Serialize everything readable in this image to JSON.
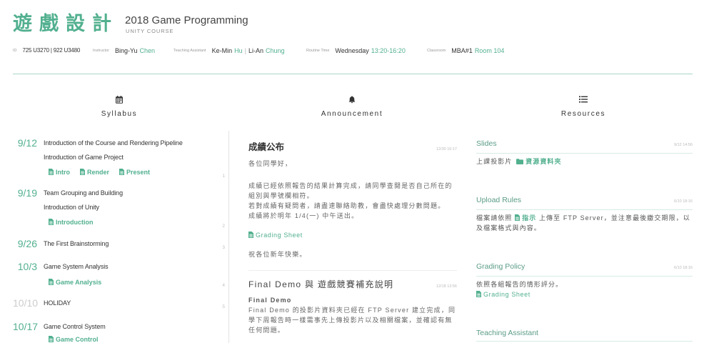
{
  "header": {
    "title": "遊戲設計",
    "course_name": "2018 Game Programming",
    "course_sub": "UNITY COURSE"
  },
  "meta": {
    "id": {
      "label": "ID",
      "value": "725 U3270 | 922 U3480"
    },
    "instructor": {
      "label": "Instructor",
      "first": "Bing-Yu",
      "last": "Chen"
    },
    "ta": {
      "label": "Teaching Assistant",
      "first1": "Ke-Min",
      "last1": "Hu",
      "sep": "|",
      "first2": "Li-An",
      "last2": "Chung"
    },
    "time": {
      "label": "Routine Time",
      "day": "Wednesday",
      "hours": "13:20-16:20"
    },
    "classroom": {
      "label": "Classroom",
      "building": "MBA#1",
      "room": "Room 104"
    }
  },
  "sections": {
    "syllabus": {
      "label": "Syllabus",
      "icon": "calendar-icon"
    },
    "announcement": {
      "label": "Announcement",
      "icon": "bell-icon"
    },
    "resources": {
      "label": "Resources",
      "icon": "list-icon"
    }
  },
  "syllabus": [
    {
      "date": "9/12",
      "week": "1",
      "topics": [
        "Introduction of the Course and Rendering Pipeline",
        "Introduction of Game Project"
      ],
      "links": [
        "Intro",
        "Render",
        "Present"
      ]
    },
    {
      "date": "9/19",
      "week": "2",
      "topics": [
        "Team Grouping and Building",
        "Introduction of Unity"
      ],
      "links": [
        "Introduction"
      ]
    },
    {
      "date": "9/26",
      "week": "3",
      "topics": [
        "The First Brainstorming"
      ],
      "links": []
    },
    {
      "date": "10/3",
      "week": "4",
      "topics": [
        "Game System Analysis"
      ],
      "links": [
        "Game Analysis"
      ]
    },
    {
      "date": "10/10",
      "week": "5",
      "topics": [
        "HOLIDAY"
      ],
      "links": []
    },
    {
      "date": "10/17",
      "topics": [
        "Game Control System"
      ],
      "links": [
        "Game Control"
      ]
    }
  ],
  "announcements": [
    {
      "title": "成績公布",
      "time": "12/30 16:17",
      "greeting": "各位同學好，",
      "body": [
        "成績已經依照報告的結果計算完成，請同學查閱是否自己所在的",
        "組別與學號欄相符。",
        "若對成績有疑問者，請盡速聯絡助教，會盡快處理分數問題。",
        "成績將於明年 1/4(一) 中午送出。"
      ],
      "link": "Grading Sheet",
      "closing": "祝各位新年快樂。"
    },
    {
      "title": "Final Demo 與 遊戲競賽補充說明",
      "time": "12/18 13:56",
      "subtitle": "Final Demo",
      "body": [
        "Final Demo 的投影片資料夾已經在 FTP Server 建立完成，同",
        "學下周報告時一樣需事先上傳投影片以及相關檔案，並確認有無",
        "任何問題。"
      ]
    }
  ],
  "resources": [
    {
      "title": "Slides",
      "time": "9/12 14:56",
      "text": "上課投影片",
      "link": "資源資料夾",
      "icon": "folder-icon"
    },
    {
      "title": "Upload Rules",
      "time": "6/10 18:16",
      "text_before": "檔案請依照",
      "link": "指示",
      "text_after": "上傳至 FTP Server，並注意最後繳交期限，以及檔案格式與內容。",
      "icon": "file-icon"
    },
    {
      "title": "Grading Policy",
      "time": "6/10 18:16",
      "text": "依照各組報告的情形評分。",
      "link": "Grading Sheet",
      "icon": "file-icon"
    },
    {
      "title": "Teaching Assistant"
    }
  ],
  "colors": {
    "accent": "#52b08f",
    "muted": "#cccccc",
    "rule": "#a9d6c6",
    "heading": "#5b9c88"
  }
}
